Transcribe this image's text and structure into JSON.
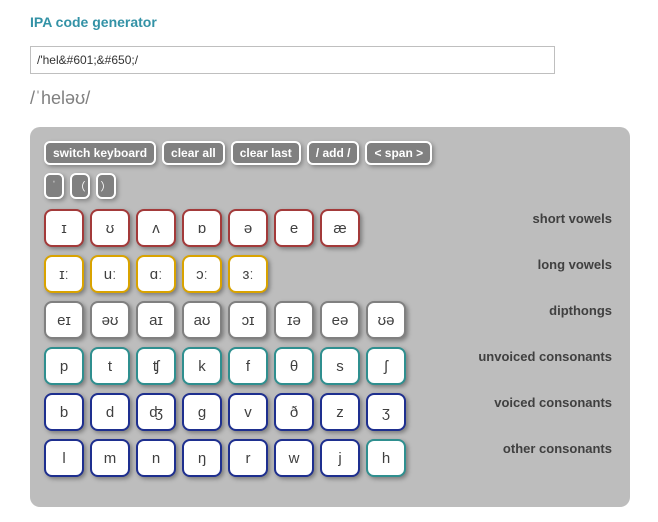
{
  "title": "IPA code generator",
  "input_value": "/'hel&#601;&#650;/",
  "output_text": "/ˈheləʊ/",
  "toolbar": {
    "switch": "switch keyboard",
    "clear_all": "clear all",
    "clear_last": "clear last",
    "slash": "/ add /",
    "span": "< span >"
  },
  "stress": [
    "ˈ",
    "（",
    "）"
  ],
  "rows": [
    {
      "label": "short vowels",
      "color": "#a33a3a",
      "keys": [
        "ɪ",
        "ʊ",
        "ʌ",
        "ɒ",
        "ə",
        "e",
        "æ"
      ]
    },
    {
      "label": "long vowels",
      "color": "#d9a300",
      "keys": [
        "ɪː",
        "uː",
        "ɑː",
        "ɔː",
        "ɜː"
      ]
    },
    {
      "label": "dipthongs",
      "color": "#808080",
      "keys": [
        "eɪ",
        "əʊ",
        "aɪ",
        "aʊ",
        "ɔɪ",
        "ɪə",
        "eə",
        "ʊə"
      ]
    },
    {
      "label": "unvoiced consonants",
      "color": "#2f8f8f",
      "keys": [
        "p",
        "t",
        "ʧ",
        "k",
        "f",
        "θ",
        "s",
        "ʃ"
      ]
    },
    {
      "label": "voiced consonants",
      "color": "#1e2f8f",
      "keys": [
        "b",
        "d",
        "ʤ",
        "g",
        "v",
        "ð",
        "z",
        "ʒ"
      ]
    },
    {
      "label": "other consonants",
      "color_map": [
        "#1e2f8f",
        "#1e2f8f",
        "#1e2f8f",
        "#1e2f8f",
        "#1e2f8f",
        "#1e2f8f",
        "#1e2f8f",
        "#2f8f8f"
      ],
      "keys": [
        "l",
        "m",
        "n",
        "ŋ",
        "r",
        "w",
        "j",
        "h"
      ]
    }
  ]
}
